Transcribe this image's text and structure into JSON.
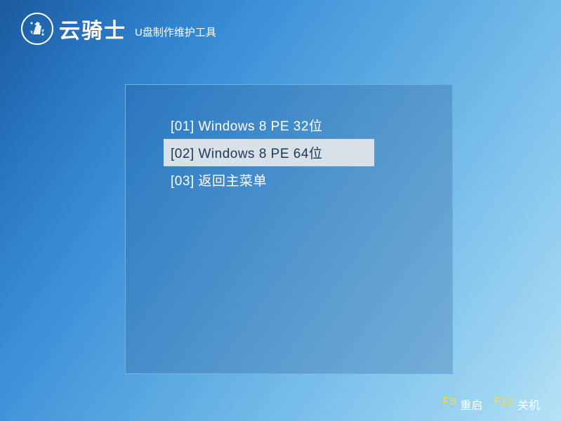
{
  "header": {
    "logo_text": "云骑士",
    "subtitle": "U盘制作维护工具"
  },
  "menu": {
    "items": [
      {
        "label": "[01] Windows 8 PE 32位",
        "selected": false
      },
      {
        "label": "[02] Windows 8 PE 64位",
        "selected": true
      },
      {
        "label": "[03] 返回主菜单",
        "selected": false
      }
    ]
  },
  "footer": {
    "key1": "F9",
    "label1": "重启",
    "key2": "F10",
    "label2": "关机"
  }
}
